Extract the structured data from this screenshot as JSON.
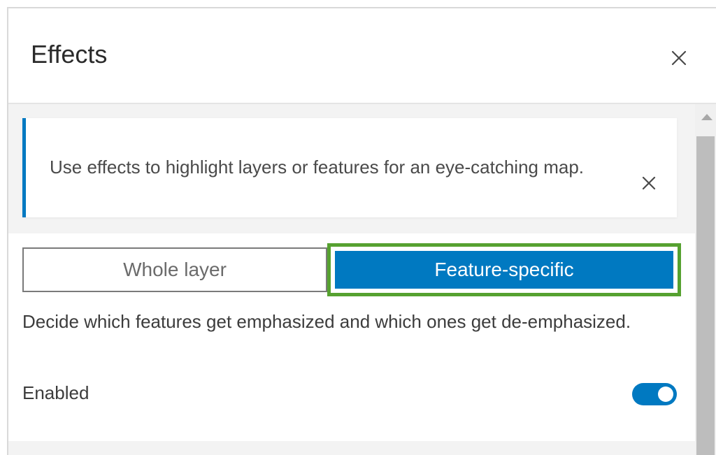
{
  "panel": {
    "title": "Effects",
    "close_icon": "close-icon"
  },
  "notice": {
    "text": "Use effects to highlight layers or features for an eye-catching map.",
    "close_icon": "close-icon",
    "accent_color": "#0079c1"
  },
  "effect_mode": {
    "options": [
      {
        "label": "Whole layer",
        "selected": false
      },
      {
        "label": "Feature-specific",
        "selected": true
      }
    ],
    "highlight_color": "#56a130",
    "selected_color": "#0079c1"
  },
  "description": "Decide which features get emphasized and which ones get de-emphasized.",
  "enabled": {
    "label": "Enabled",
    "value": true
  }
}
